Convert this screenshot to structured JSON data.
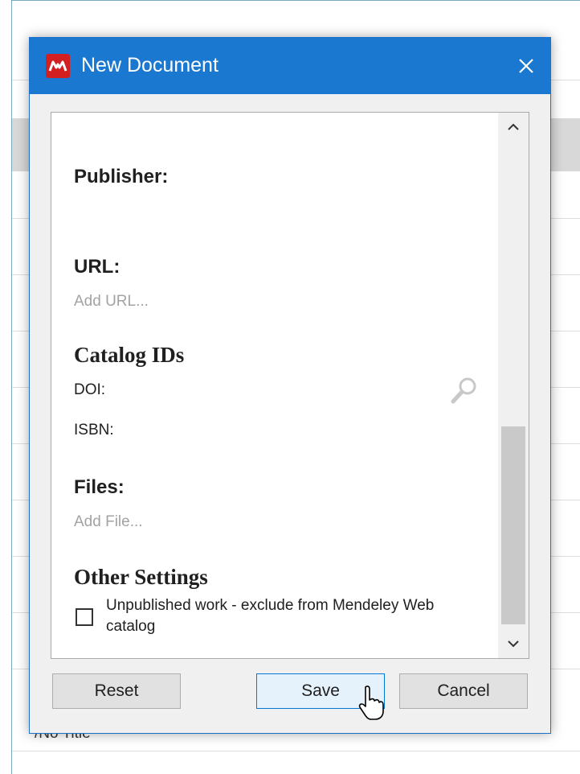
{
  "background": {
    "row_label": "/No Title"
  },
  "dialog": {
    "title": "New Document",
    "close_glyph": "✕",
    "icons": {
      "app_logo": "mendeley-logo-icon",
      "close": "close-icon",
      "search": "magnifier-icon"
    },
    "colors": {
      "titlebar": "#1a78d0",
      "logo": "#d31f1f",
      "placeholder_text": "#a3a3a3"
    }
  },
  "form": {
    "publisher": {
      "label": "Publisher:",
      "value": ""
    },
    "url": {
      "label": "URL:",
      "placeholder": "Add URL..."
    },
    "catalog_ids": {
      "heading": "Catalog IDs",
      "doi_label": "DOI:",
      "isbn_label": "ISBN:"
    },
    "files": {
      "label": "Files:",
      "placeholder": "Add File..."
    },
    "other_settings": {
      "heading": "Other Settings",
      "unpublished_label": "Unpublished work - exclude from Mendeley Web catalog",
      "unpublished_checked": false
    }
  },
  "buttons": {
    "reset": "Reset",
    "save": "Save",
    "cancel": "Cancel"
  }
}
